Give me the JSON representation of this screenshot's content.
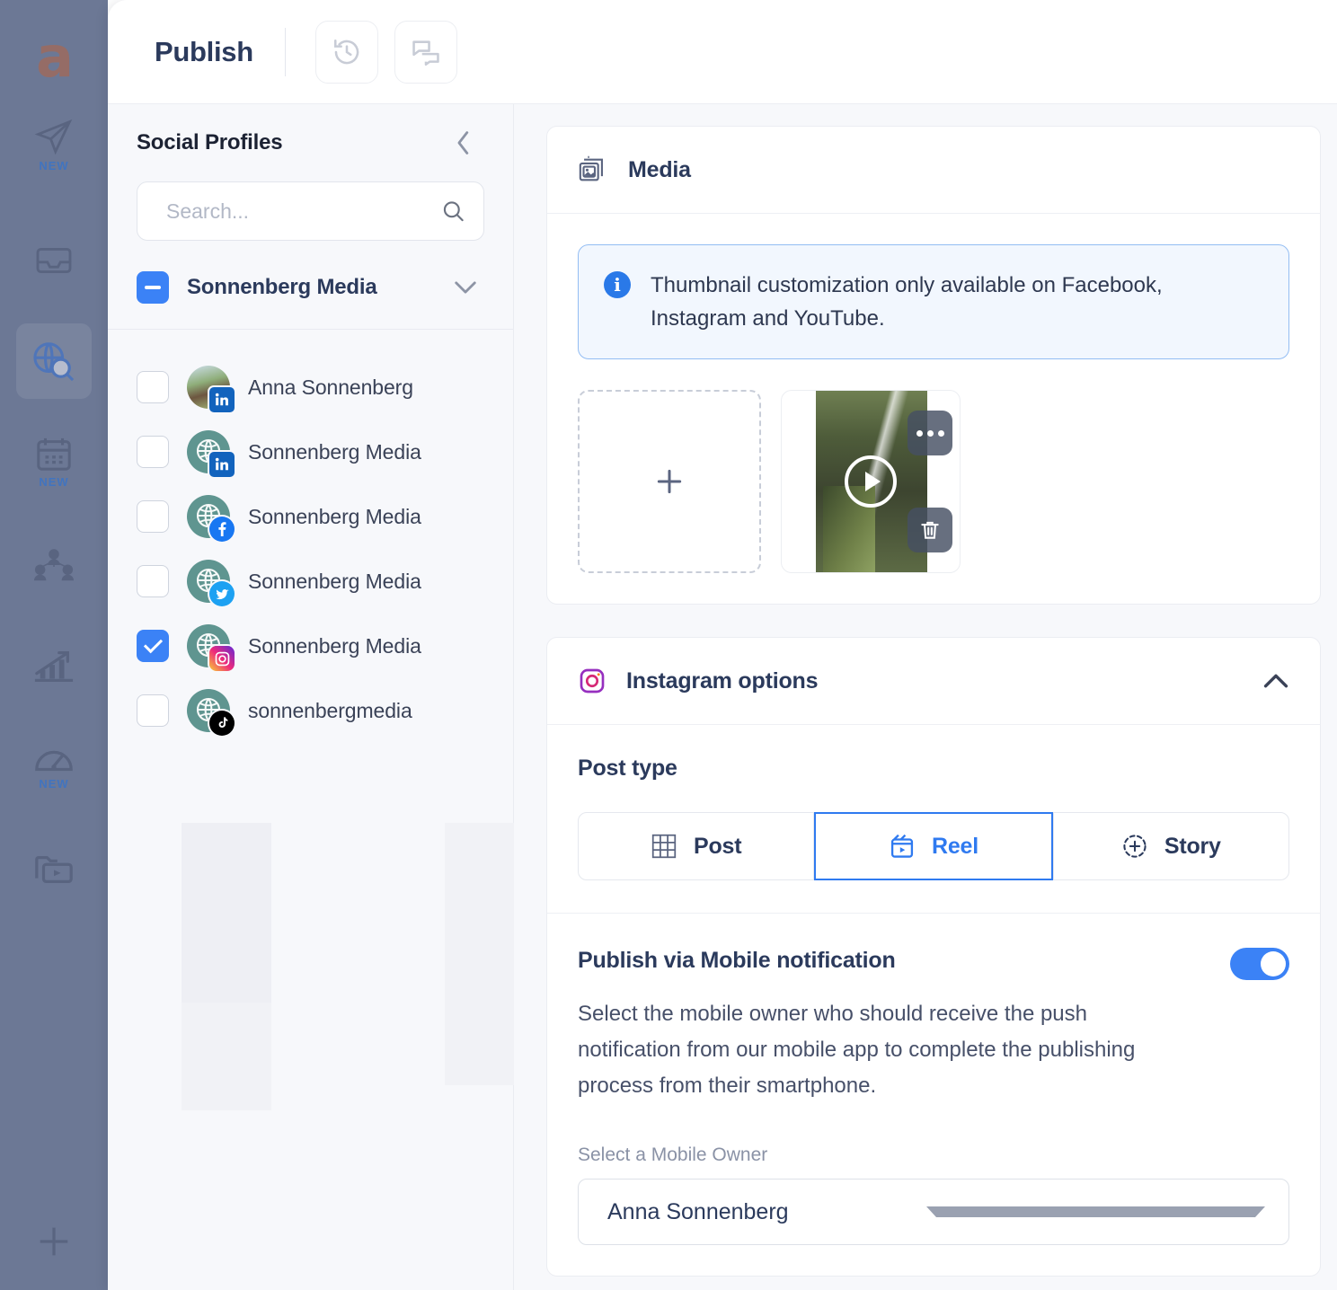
{
  "brand": {
    "logo_letter": "a",
    "accent": "#3b82f6",
    "rail_bg": "#6b7794",
    "logo_color": "#b5623f"
  },
  "rail": {
    "items": [
      {
        "name": "publish-icon",
        "badge": "NEW"
      },
      {
        "name": "inbox-icon",
        "badge": ""
      },
      {
        "name": "listening-globe-search-icon",
        "badge": "",
        "active": true
      },
      {
        "name": "calendar-icon",
        "badge": "NEW"
      },
      {
        "name": "audience-icon",
        "badge": ""
      },
      {
        "name": "analytics-icon",
        "badge": ""
      },
      {
        "name": "dashboard-gauge-icon",
        "badge": "NEW"
      },
      {
        "name": "media-library-icon",
        "badge": ""
      }
    ],
    "add_label": "+"
  },
  "topbar": {
    "title": "Publish",
    "history_icon": "history-icon",
    "comments_icon": "comments-icon"
  },
  "sidebar": {
    "title": "Social Profiles",
    "collapse_icon": "chevron-left-icon",
    "search": {
      "placeholder": "Search...",
      "value": "",
      "icon": "search-icon"
    },
    "group": {
      "label": "Sonnenberg Media",
      "state": "indeterminate",
      "chevron": "chevron-down-icon"
    },
    "profiles": [
      {
        "name": "Anna Sonnenberg",
        "network": "linkedin",
        "checked": false,
        "photo": true
      },
      {
        "name": "Sonnenberg Media",
        "network": "linkedin",
        "checked": false,
        "photo": false
      },
      {
        "name": "Sonnenberg Media",
        "network": "facebook",
        "checked": false,
        "photo": false
      },
      {
        "name": "Sonnenberg Media",
        "network": "twitter",
        "checked": false,
        "photo": false
      },
      {
        "name": "Sonnenberg Media",
        "network": "instagram",
        "checked": true,
        "photo": false
      },
      {
        "name": "sonnenbergmedia",
        "network": "tiktok",
        "checked": false,
        "photo": false
      }
    ]
  },
  "media": {
    "title": "Media",
    "icon": "images-icon",
    "info": "Thumbnail customization only available on Facebook, Instagram and YouTube.",
    "add_icon": "plus-icon",
    "thumb": {
      "alt": "waterfall video thumbnail",
      "play_icon": "play-icon",
      "more_icon": "more-options-icon",
      "delete_icon": "trash-icon"
    }
  },
  "instagram": {
    "title": "Instagram options",
    "icon": "instagram-icon",
    "collapse_icon": "chevron-up-icon",
    "post_type_label": "Post type",
    "post_types": [
      {
        "label": "Post",
        "icon": "grid-icon",
        "selected": false
      },
      {
        "label": "Reel",
        "icon": "reel-icon",
        "selected": true
      },
      {
        "label": "Story",
        "icon": "story-plus-icon",
        "selected": false
      }
    ],
    "mobile": {
      "title": "Publish via Mobile notification",
      "enabled": true,
      "description": "Select the mobile owner who should receive the push notification from our mobile app to complete the publishing process from their smartphone.",
      "select_label": "Select a Mobile Owner",
      "selected_owner": "Anna Sonnenberg",
      "caret_icon": "caret-down-icon"
    }
  }
}
